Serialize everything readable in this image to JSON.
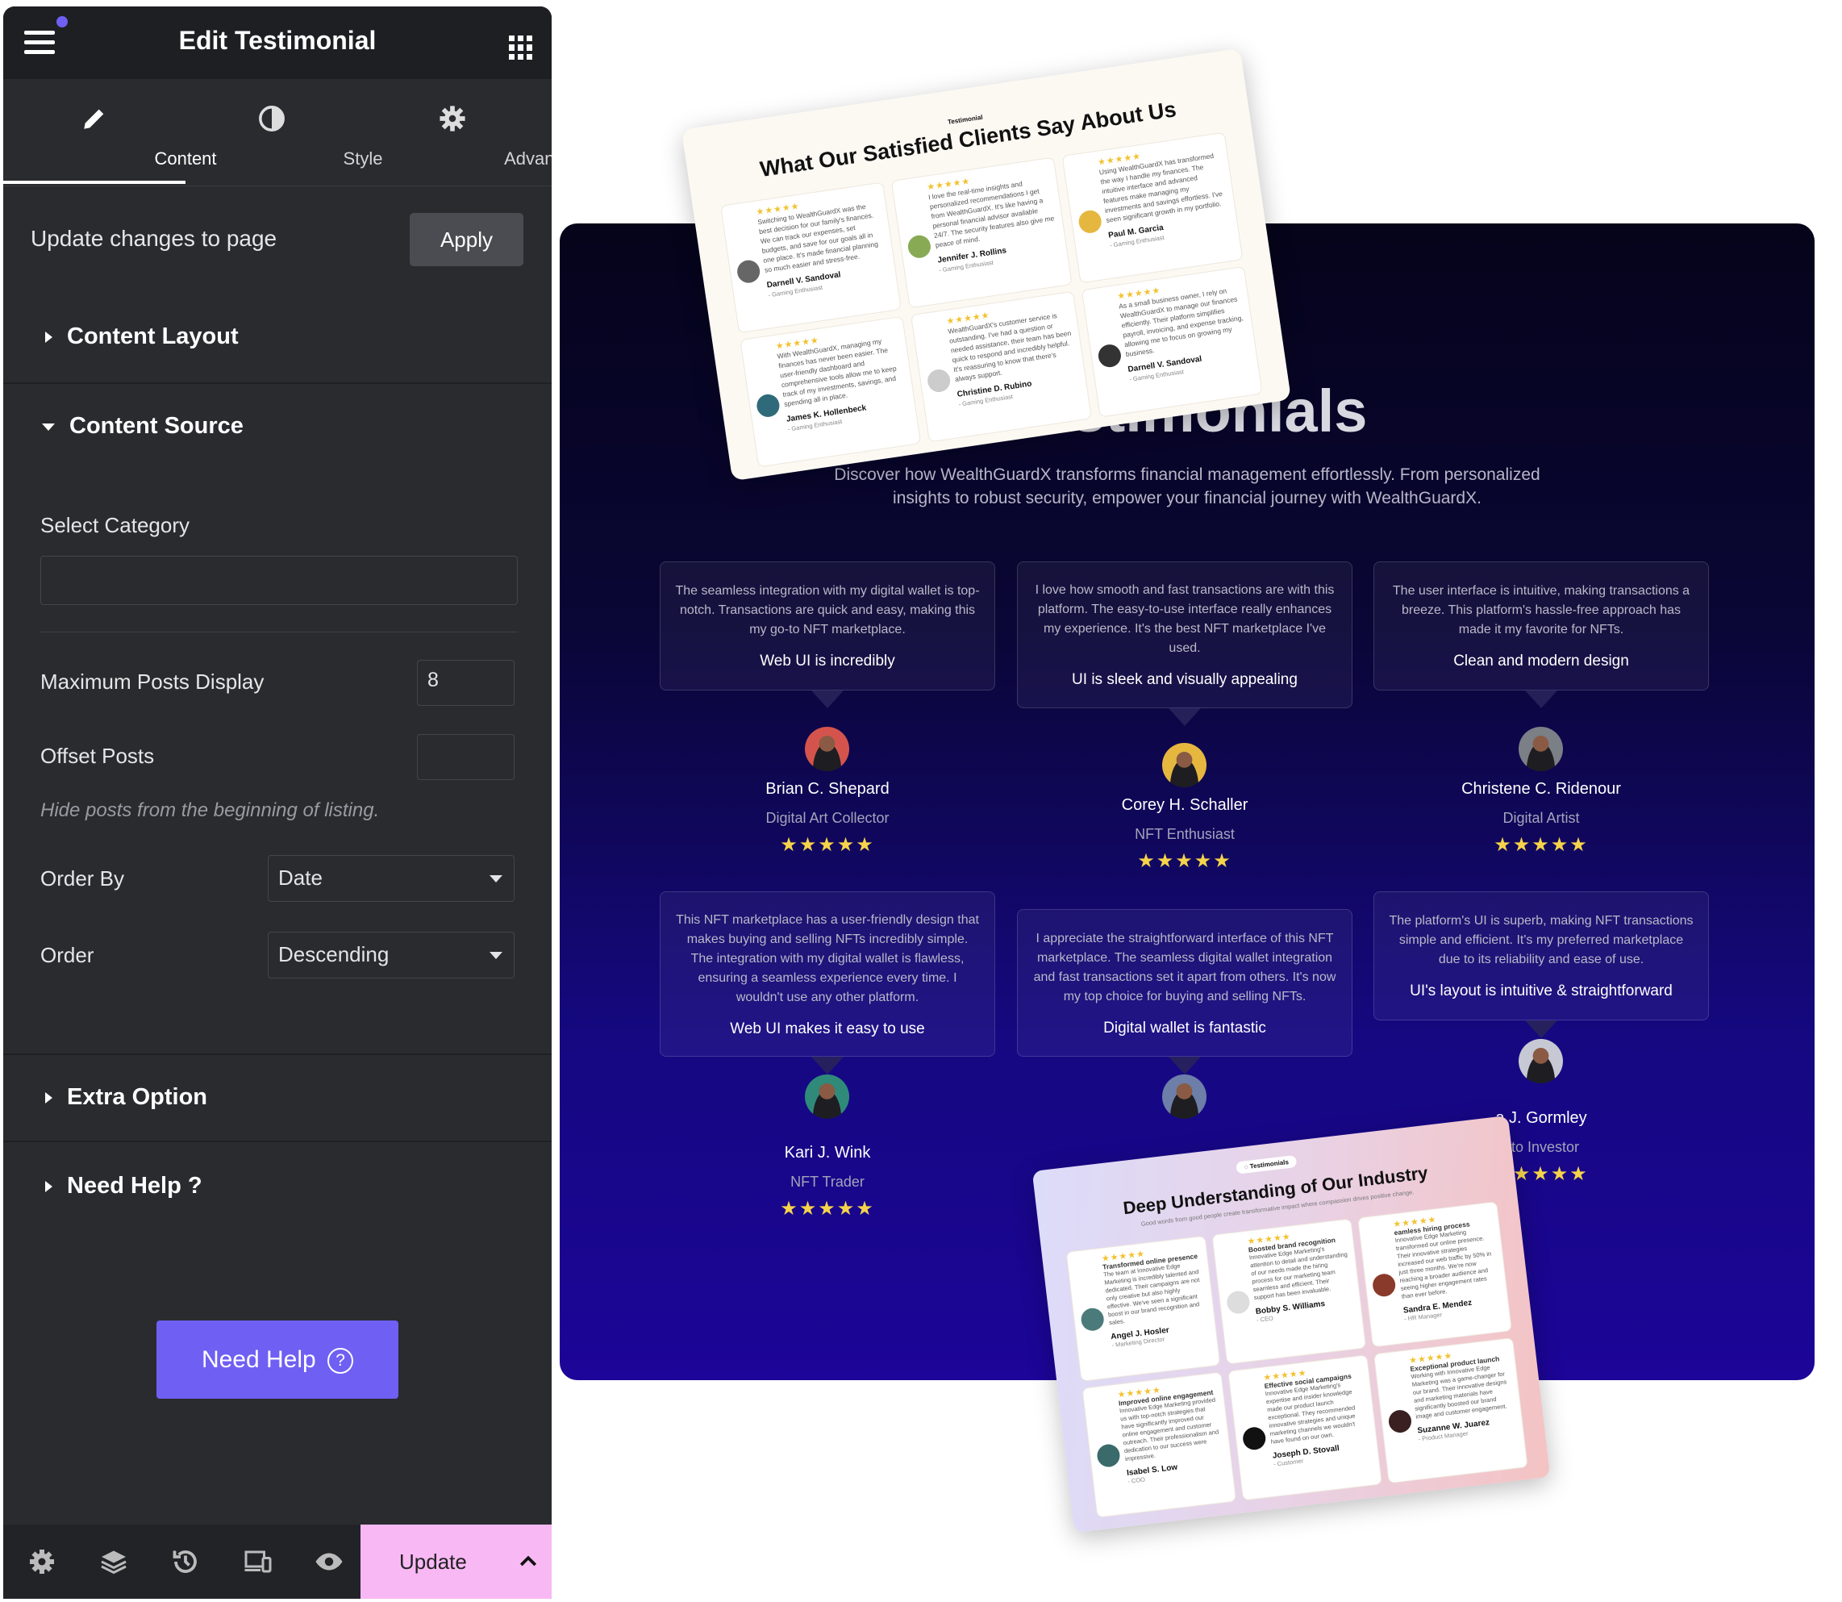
{
  "sidebar": {
    "title": "Edit Testimonial",
    "tabs": [
      {
        "label": "Content"
      },
      {
        "label": "Style"
      },
      {
        "label": "Advanced"
      }
    ],
    "update_changes_label": "Update changes to page",
    "apply_label": "Apply",
    "sections": {
      "content_layout": "Content Layout",
      "content_source": "Content Source",
      "extra_option": "Extra Option",
      "need_help": "Need Help ?"
    },
    "select_category_label": "Select Category",
    "select_category_value": "",
    "max_posts_label": "Maximum Posts Display",
    "max_posts_value": "8",
    "offset_label": "Offset Posts",
    "offset_value": "",
    "offset_hint": "Hide posts from the beginning of listing.",
    "order_by_label": "Order By",
    "order_by_value": "Date",
    "order_label": "Order",
    "order_value": "Descending",
    "need_help_button": "Need Help",
    "update_label": "Update",
    "accent_color": "#6f5ff3",
    "update_color": "#f8b8f4"
  },
  "preview": {
    "title": "Testimonials",
    "subtitle_line1": "Discover how WealthGuardX transforms financial management effortlessly. From personalized",
    "subtitle_line2": "insights to robust security, empower your financial journey with WealthGuardX.",
    "stars": "★★★★★",
    "testimonials": [
      {
        "quote": "The seamless integration with my digital wallet is top-notch. Transactions are quick and easy, making this my go-to NFT marketplace.",
        "title": "Web UI is incredibly",
        "name": "Brian C. Shepard",
        "role": "Digital Art Collector"
      },
      {
        "quote": "I love how smooth and fast transactions are with this platform. The easy-to-use interface really enhances my experience. It's the best NFT marketplace I've used.",
        "title": "UI is sleek and visually appealing",
        "name": "Corey H. Schaller",
        "role": "NFT Enthusiast"
      },
      {
        "quote": "The user interface is intuitive, making transactions a breeze. This platform's hassle-free approach has made it my favorite for NFTs.",
        "title": "Clean and modern design",
        "name": "Christene C. Ridenour",
        "role": "Digital Artist"
      },
      {
        "quote": "This NFT marketplace has a user-friendly design that makes buying and selling NFTs incredibly simple. The integration with my digital wallet is flawless, ensuring a seamless experience every time. I wouldn't use any other platform.",
        "title": "Web UI makes it easy to use",
        "name": "Kari J. Wink",
        "role": "NFT Trader"
      },
      {
        "quote": "I appreciate the straightforward interface of this NFT marketplace. The seamless digital wallet integration and fast transactions set it apart from others. It's now my top choice for buying and selling NFTs.",
        "title": "Digital wallet is fantastic",
        "name": "",
        "role": ""
      },
      {
        "quote": "The platform's UI is superb, making NFT transactions simple and efficient. It's my preferred marketplace due to its reliability and ease of use.",
        "title": "UI's layout is intuitive & straightforward",
        "name": "a J. Gormley",
        "role": "pto Investor"
      }
    ]
  },
  "overlay_top": {
    "label": "Testimonial",
    "title": "What Our Satisfied Clients Say About Us",
    "cards": [
      {
        "text": "Switching to WealthGuardX was the best decision for our family's finances. We can track our expenses, set budgets, and save for our goals all in one place. It's made financial planning so much easier and stress-free.",
        "name": "Darnell V. Sandoval",
        "role": "- Gaming Enthusiast"
      },
      {
        "text": "I love the real-time insights and personalized recommendations I get from WealthGuardX. It's like having a personal financial advisor available 24/7. The security features also give me peace of mind.",
        "name": "Jennifer J. Rollins",
        "role": "- Gaming Enthusiast"
      },
      {
        "text": "Using WealthGuardX has transformed the way I handle my finances. The intuitive interface and advanced features make managing my investments and savings effortless. I've seen significant growth in my portfolio.",
        "name": "Paul M. Garcia",
        "role": "- Gaming Enthusiast"
      },
      {
        "text": "With WealthGuardX, managing my finances has never been easier. The user-friendly dashboard and comprehensive tools allow me to keep track of my investments, savings, and spending all in place.",
        "name": "James K. Hollenbeck",
        "role": "- Gaming Enthusiast"
      },
      {
        "text": "WealthGuardX's customer service is outstanding. I've had a question or needed assistance, their team has been quick to respond and incredibly helpful. It's reassuring to know that there's always support.",
        "name": "Christine D. Rubino",
        "role": "- Gaming Enthusiast"
      },
      {
        "text": "As a small business owner, I rely on WealthGuardX to manage our finances efficiently. Their platform simplifies payroll, invoicing, and expense tracking, allowing me to focus on growing my business.",
        "name": "Darnell V. Sandoval",
        "role": "- Gaming Enthusiast"
      }
    ]
  },
  "overlay_bottom": {
    "pill": "Testimonials",
    "title": "Deep Understanding of Our Industry",
    "subtitle": "Good words from good people create transformative impact where compassion drives positive change.",
    "cards": [
      {
        "heading": "Transformed online presence",
        "text": "The team at Innovative Edge Marketing is incredibly talented and dedicated. Their campaigns are not only creative but also highly effective. We've seen a significant boost in our brand recognition and sales.",
        "name": "Angel J. Hosler",
        "role": "- Marketing Director"
      },
      {
        "heading": "Boosted brand recognition",
        "text": "Innovative Edge Marketing's attention to detail and understanding of our needs made the hiring process for our marketing team seamless and efficient. Their support has been invaluable.",
        "name": "Bobby S. Williams",
        "role": "- CEO"
      },
      {
        "heading": "eamless hiring process",
        "text": "Innovative Edge Marketing transformed our online presence. Their innovative strategies increased our web traffic by 50% in just three months. We're now reaching a broader audience and seeing higher engagement rates than ever before.",
        "name": "Sandra E. Mendez",
        "role": "- HR Manager"
      },
      {
        "heading": "Improved online engagement",
        "text": "Innovative Edge Marketing provided us with top-notch strategies that have significantly improved our online engagement and customer outreach. Their professionalism and dedication to our success were impressive.",
        "name": "Isabel S. Low",
        "role": "- COO"
      },
      {
        "heading": "Effective social campaigns",
        "text": "Innovative Edge Marketing's expertise and insider knowledge made our product launch exceptional. They recommended innovative strategies and unique marketing channels we wouldn't have found on our own.",
        "name": "Joseph D. Stovall",
        "role": "- Customer"
      },
      {
        "heading": "Exceptional product launch",
        "text": "Working with Innovative Edge Marketing was a game-changer for our brand. Their innovative designs and marketing materials have significantly boosted our brand image and customer engagement.",
        "name": "Suzanne W. Juarez",
        "role": "- Product Manager"
      }
    ]
  }
}
